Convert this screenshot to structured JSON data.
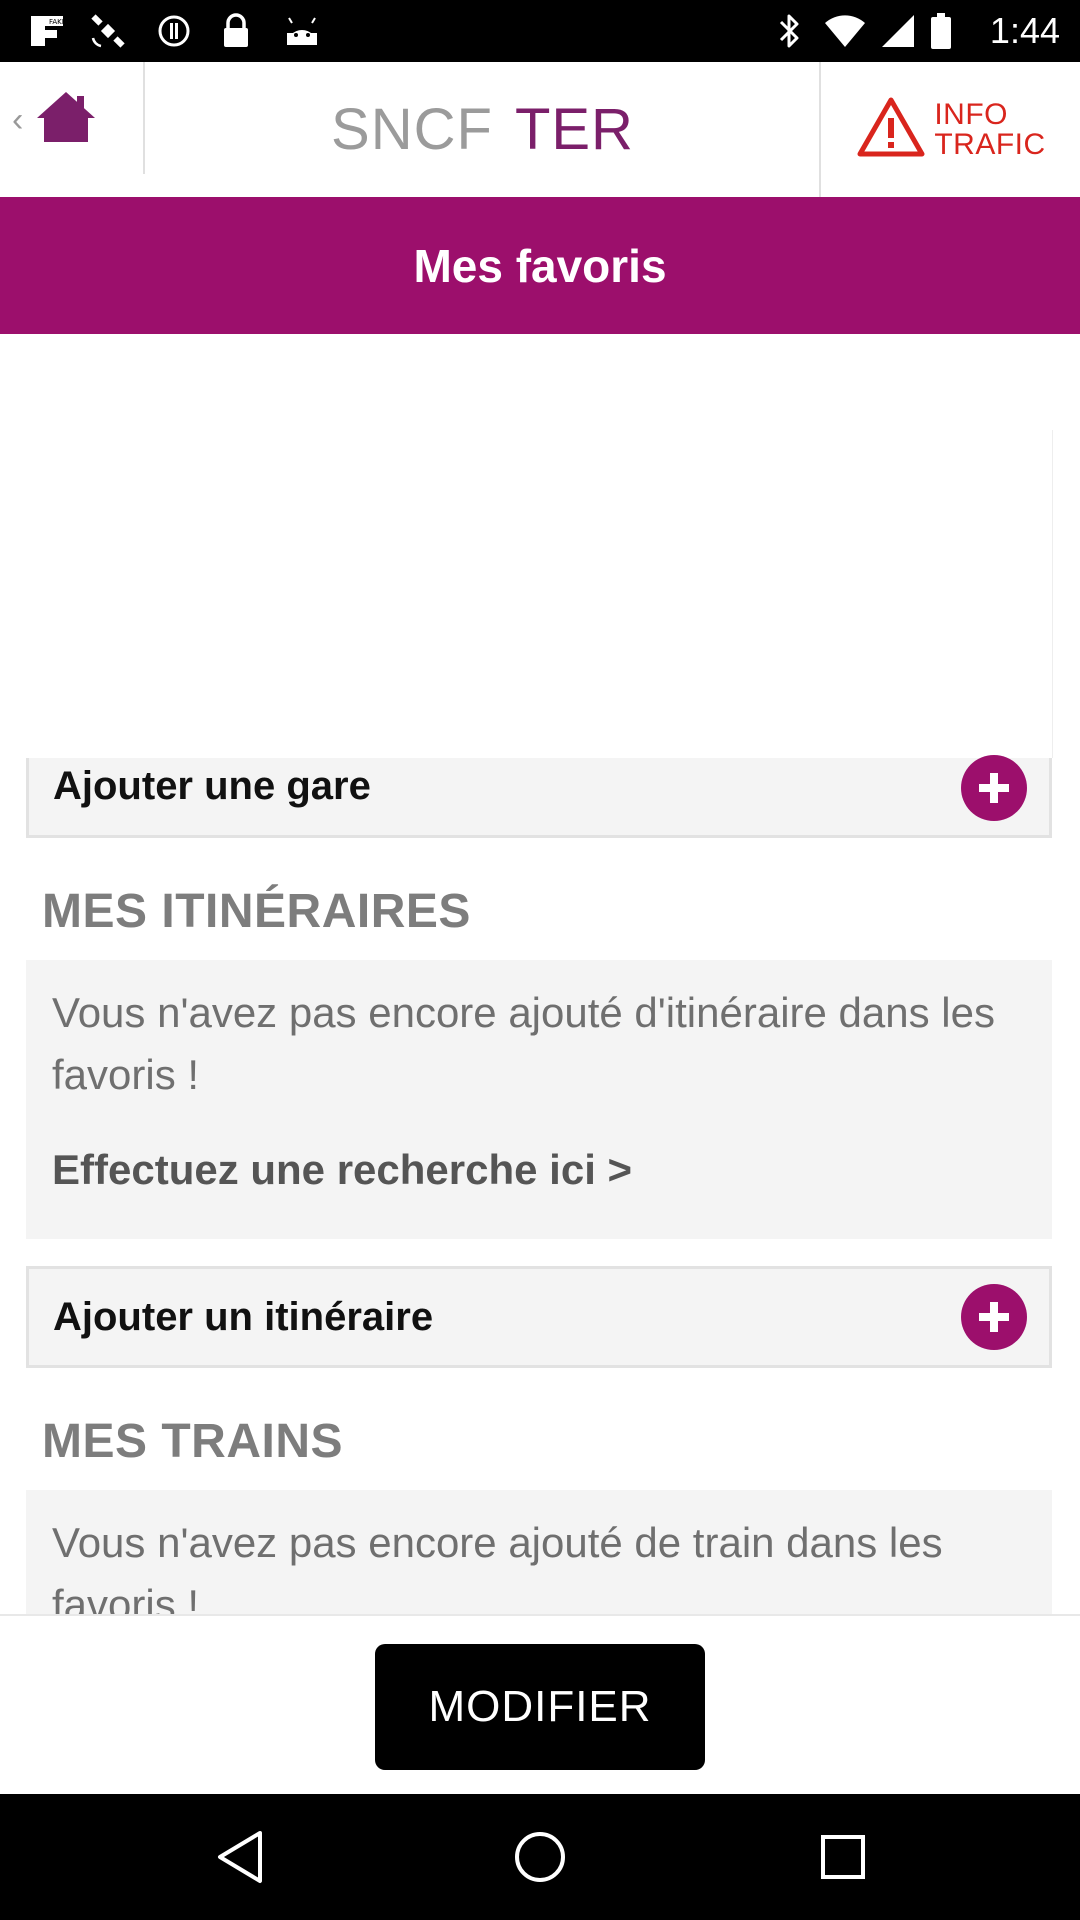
{
  "status_bar": {
    "time": "1:44",
    "icons": [
      "fake-gps-icon",
      "satellite-icon",
      "sync-icon",
      "lock-icon",
      "android-icon",
      "bluetooth-icon",
      "wifi-icon",
      "signal-icon",
      "battery-icon"
    ],
    "badge_text": "FAKE"
  },
  "header": {
    "back_glyph": "‹",
    "brand_sncf": "SNCF",
    "brand_ter": "TER",
    "info_line1": "INFO",
    "info_line2": "TRAFIC",
    "brand_color": "#7b1f6a",
    "alert_color": "#d9251d"
  },
  "page_title": "Mes favoris",
  "accent_color": "#9c0f6c",
  "stations": {
    "add_label": "Ajouter une gare"
  },
  "itineraries": {
    "section_title": "MES ITINÉRAIRES",
    "empty_message": "Vous n'avez pas encore ajouté d'itinéraire dans les favoris !",
    "search_link": "Effectuez une recherche ici >",
    "add_label": "Ajouter un itinéraire"
  },
  "trains": {
    "section_title": "MES TRAINS",
    "empty_message": "Vous n'avez pas encore ajouté de train dans les favoris !"
  },
  "actions": {
    "modify_label": "MODIFIER"
  },
  "nav_bar": {
    "buttons": [
      "back-triangle-icon",
      "home-circle-icon",
      "recents-square-icon"
    ]
  }
}
